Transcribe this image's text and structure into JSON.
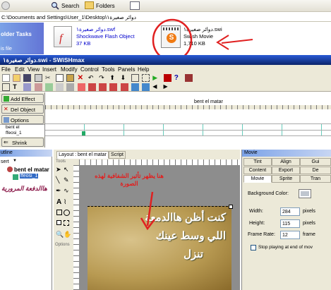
{
  "explorer": {
    "toolbar": {
      "search": "Search",
      "folders": "Folders"
    },
    "address": "C:\\Documents and Settings\\User_1\\Desktop\\دوائر صغيرة١",
    "folder_tasks": "older Tasks",
    "file_this": "is file",
    "files": [
      {
        "name": "دوائر صغيرة١.swf",
        "type": "Shockwave Flash Object",
        "size": "37 KB",
        "icon": "flash-icon"
      },
      {
        "name": "دوائر صغيرة١.swi",
        "type": "Swish Movie",
        "size": "1,710 KB",
        "icon": "swish-icon"
      }
    ]
  },
  "swish": {
    "title": "دوائر صغيرة١.swi - SWiSHmax",
    "menu": [
      "File",
      "Edit",
      "View",
      "Insert",
      "Modify",
      "Control",
      "Tools",
      "Panels",
      "Help"
    ],
    "scene_buttons": {
      "add_effect": "Add Effect",
      "del_object": "Del Object",
      "options": "Options",
      "shrink": "Shrink"
    },
    "timeline": {
      "scene_label": "bent el matar",
      "layer1": "bent el",
      "layer2": "ffeosi_1"
    },
    "outline": {
      "title": "utline",
      "insert": "sert",
      "root": "bent el matar",
      "child": "ffeosi_1",
      "arabic_label": "هاالدفعة المرورية"
    },
    "layout": {
      "tab_layout": "Layout : bent el matar",
      "tab_script": "Script",
      "tools_label": "Tools",
      "options_label": "Options",
      "annotation": "هنا يظهر تأثير الشفافية لهذه الصورة",
      "poem_lines": [
        "كنت أظن هاالدمعة",
        "اللي وسط عينك",
        "تنزل"
      ]
    },
    "movie_panel": {
      "title": "Movie",
      "tabs_row1": [
        "Tint",
        "Align",
        "Gui"
      ],
      "tabs_row2": [
        "Content",
        "Export",
        "De"
      ],
      "tabs_row3": [
        "Movie",
        "Sprite",
        "Tran"
      ],
      "background_color_label": "Background Color:",
      "width_label": "Width:",
      "width_value": "284",
      "width_unit": "pixels",
      "height_label": "Height:",
      "height_value": "115",
      "height_unit": "pixels",
      "frame_rate_label": "Frame Rate:",
      "frame_rate_value": "12",
      "frame_rate_unit": "frame",
      "stop_label": "Stop playing at end of mov"
    }
  },
  "colors": {
    "annotation_red": "#e02020",
    "xp_blue": "#3169c6",
    "title_bar": "#0a246a",
    "canvas_olive": "#b8a060"
  }
}
